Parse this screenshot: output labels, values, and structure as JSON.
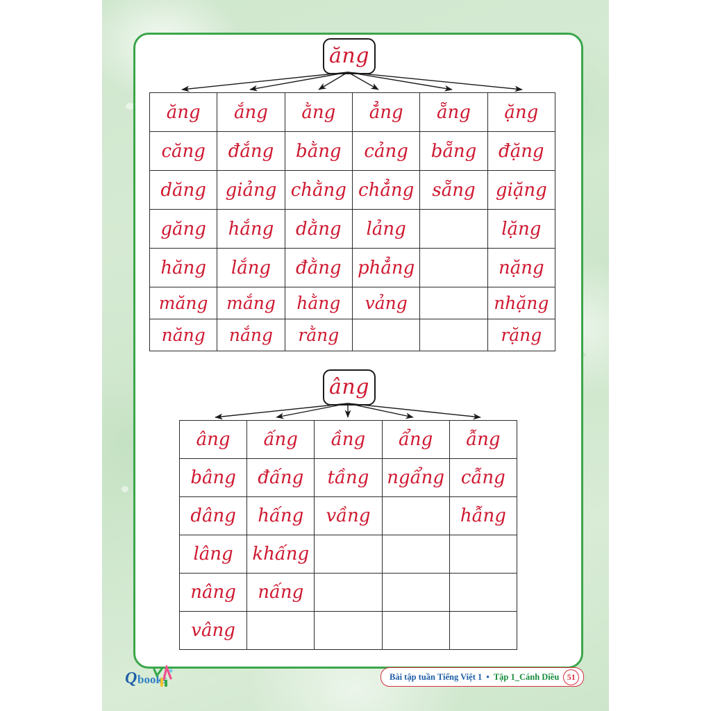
{
  "page": {
    "accent_green": "#3aa64a",
    "ink_red": "#cf1830",
    "background_green": "#d2e8cf",
    "footer_blue": "#1f5fa8",
    "footer_green": "#168c3c",
    "footer_red": "#d8303f"
  },
  "section1": {
    "root": "ăng",
    "headers": [
      "ăng",
      "ắng",
      "ằng",
      "ẳng",
      "ẵng",
      "ặng"
    ],
    "rows": [
      [
        "căng",
        "đắng",
        "bằng",
        "cảng",
        "bẵng",
        "đặng"
      ],
      [
        "dăng",
        "giảng",
        "chằng",
        "chẳng",
        "sẵng",
        "giặng"
      ],
      [
        "găng",
        "hắng",
        "dằng",
        "lảng",
        "",
        "lặng"
      ],
      [
        "hăng",
        "lắng",
        "đằng",
        "phẳng",
        "",
        "nặng"
      ],
      [
        "măng",
        "mắng",
        "hằng",
        "vảng",
        "",
        "nhặng"
      ],
      [
        "năng",
        "nắng",
        "rằng",
        "",
        "",
        "rặng"
      ]
    ]
  },
  "section2": {
    "root": "âng",
    "headers": [
      "âng",
      "ấng",
      "ầng",
      "ẩng",
      "ẫng"
    ],
    "rows": [
      [
        "bâng",
        "đấng",
        "tầng",
        "ngẩng",
        "cẫng"
      ],
      [
        "dâng",
        "hấng",
        "vầng",
        "",
        "hẫng"
      ],
      [
        "lâng",
        "khấng",
        "",
        "",
        ""
      ],
      [
        "nâng",
        "nấng",
        "",
        "",
        ""
      ],
      [
        "vâng",
        "",
        "",
        "",
        ""
      ]
    ]
  },
  "footer": {
    "title_blue": "Bài tập tuần Tiếng Việt 1",
    "separator": "•",
    "title_green": "Tập 1_Cánh Diều",
    "page_number": "51"
  },
  "logo": {
    "name": "Qbooks",
    "part1": "Q",
    "part2": "books"
  }
}
